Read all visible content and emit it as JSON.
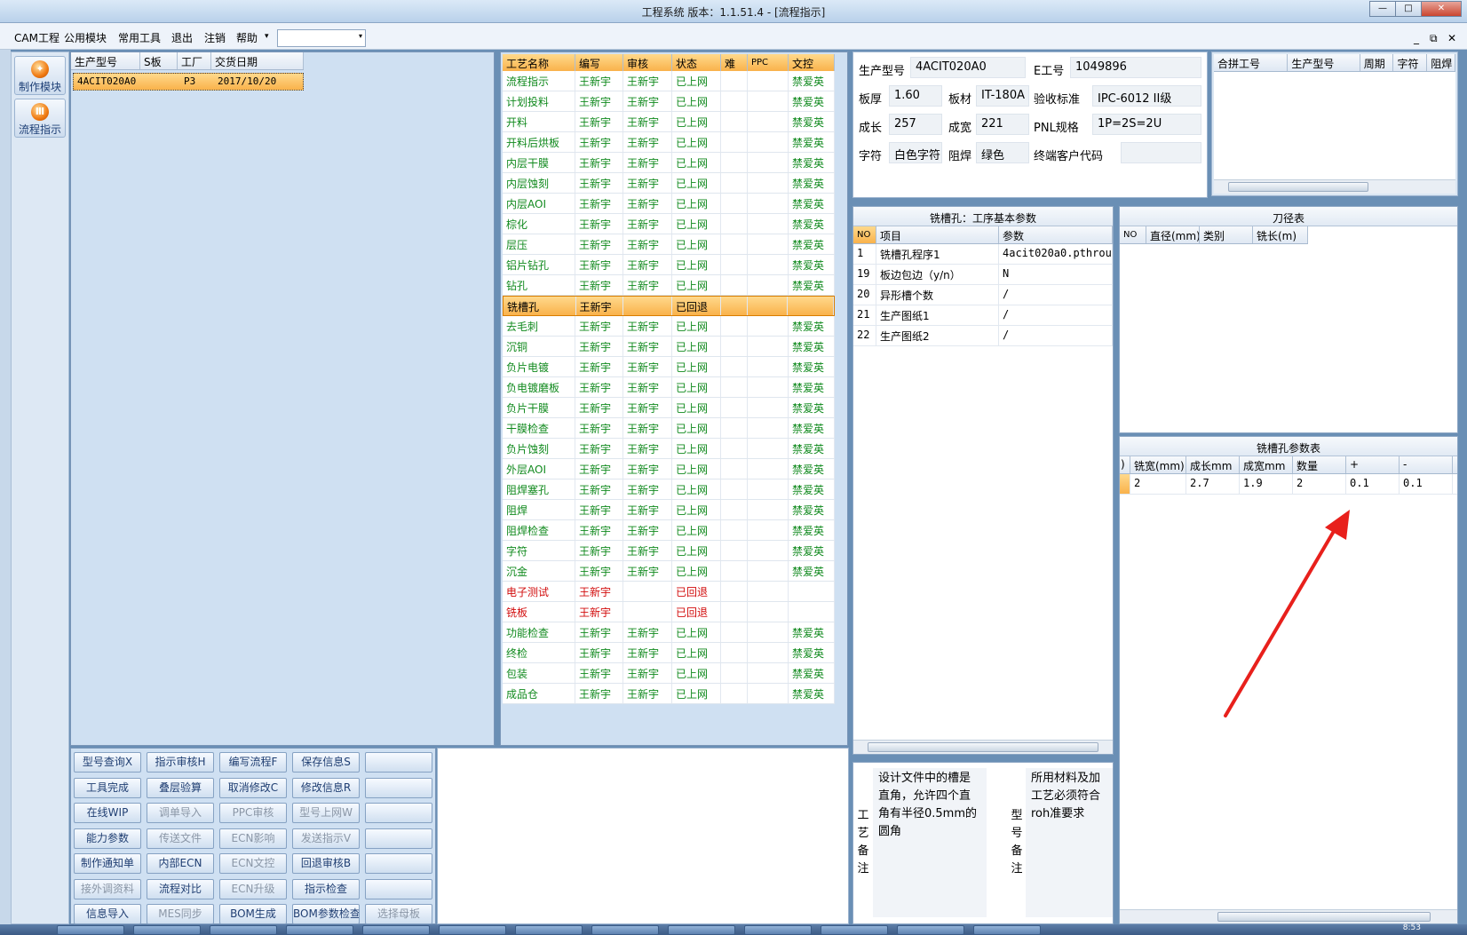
{
  "window": {
    "title": "工程系统   版本：1.1.51.4 - [流程指示]",
    "minimize": "—",
    "maximize": "□",
    "close": "✕"
  },
  "menu": {
    "items": [
      "CAM工程",
      "公用模块",
      "常用工具",
      "退出",
      "注销",
      "帮助"
    ],
    "help_arrow": "▾",
    "combo_value": "",
    "combo_arrow": "▾",
    "mdi_min": "_",
    "mdi_restore": "⧉",
    "mdi_close": "✕"
  },
  "sidebar": {
    "items": [
      {
        "label": "制作模块",
        "icon": "flame-icon",
        "glyph": "✦"
      },
      {
        "label": "流程指示",
        "icon": "flow-icon",
        "glyph": "Ⅲ"
      }
    ]
  },
  "model_list": {
    "headers": [
      "生产型号",
      "S板",
      "工厂",
      "交货日期"
    ],
    "rows": [
      {
        "model": "4ACIT020A0",
        "s": "",
        "factory": "P3",
        "date": "2017/10/20"
      }
    ]
  },
  "process": {
    "headers": [
      "工艺名称",
      "编写",
      "审核",
      "状态",
      "难",
      "PPC",
      "文控"
    ],
    "rows": [
      {
        "name": "流程指示",
        "writer": "王新宇",
        "reviewer": "王新宇",
        "status": "已上网",
        "hard": "",
        "ppc": "",
        "doc": "禁爱英"
      },
      {
        "name": "计划投料",
        "writer": "王新宇",
        "reviewer": "王新宇",
        "status": "已上网",
        "hard": "",
        "ppc": "",
        "doc": "禁爱英"
      },
      {
        "name": "开料",
        "writer": "王新宇",
        "reviewer": "王新宇",
        "status": "已上网",
        "hard": "",
        "ppc": "",
        "doc": "禁爱英"
      },
      {
        "name": "开料后烘板",
        "writer": "王新宇",
        "reviewer": "王新宇",
        "status": "已上网",
        "hard": "",
        "ppc": "",
        "doc": "禁爱英"
      },
      {
        "name": "内层干膜",
        "writer": "王新宇",
        "reviewer": "王新宇",
        "status": "已上网",
        "hard": "",
        "ppc": "",
        "doc": "禁爱英"
      },
      {
        "name": "内层蚀刻",
        "writer": "王新宇",
        "reviewer": "王新宇",
        "status": "已上网",
        "hard": "",
        "ppc": "",
        "doc": "禁爱英"
      },
      {
        "name": "内层AOI",
        "writer": "王新宇",
        "reviewer": "王新宇",
        "status": "已上网",
        "hard": "",
        "ppc": "",
        "doc": "禁爱英"
      },
      {
        "name": "棕化",
        "writer": "王新宇",
        "reviewer": "王新宇",
        "status": "已上网",
        "hard": "",
        "ppc": "",
        "doc": "禁爱英"
      },
      {
        "name": "层压",
        "writer": "王新宇",
        "reviewer": "王新宇",
        "status": "已上网",
        "hard": "",
        "ppc": "",
        "doc": "禁爱英"
      },
      {
        "name": "铝片钻孔",
        "writer": "王新宇",
        "reviewer": "王新宇",
        "status": "已上网",
        "hard": "",
        "ppc": "",
        "doc": "禁爱英"
      },
      {
        "name": "钻孔",
        "writer": "王新宇",
        "reviewer": "王新宇",
        "status": "已上网",
        "hard": "",
        "ppc": "",
        "doc": "禁爱英"
      },
      {
        "name": "铣槽孔",
        "writer": "王新宇",
        "reviewer": "",
        "status": "已回退",
        "hard": "",
        "ppc": "",
        "doc": "",
        "sel": true
      },
      {
        "name": "去毛刺",
        "writer": "王新宇",
        "reviewer": "王新宇",
        "status": "已上网",
        "hard": "",
        "ppc": "",
        "doc": "禁爱英"
      },
      {
        "name": "沉铜",
        "writer": "王新宇",
        "reviewer": "王新宇",
        "status": "已上网",
        "hard": "",
        "ppc": "",
        "doc": "禁爱英"
      },
      {
        "name": "负片电镀",
        "writer": "王新宇",
        "reviewer": "王新宇",
        "status": "已上网",
        "hard": "",
        "ppc": "",
        "doc": "禁爱英"
      },
      {
        "name": "负电镀磨板",
        "writer": "王新宇",
        "reviewer": "王新宇",
        "status": "已上网",
        "hard": "",
        "ppc": "",
        "doc": "禁爱英"
      },
      {
        "name": "负片干膜",
        "writer": "王新宇",
        "reviewer": "王新宇",
        "status": "已上网",
        "hard": "",
        "ppc": "",
        "doc": "禁爱英"
      },
      {
        "name": "干膜检查",
        "writer": "王新宇",
        "reviewer": "王新宇",
        "status": "已上网",
        "hard": "",
        "ppc": "",
        "doc": "禁爱英"
      },
      {
        "name": "负片蚀刻",
        "writer": "王新宇",
        "reviewer": "王新宇",
        "status": "已上网",
        "hard": "",
        "ppc": "",
        "doc": "禁爱英"
      },
      {
        "name": "外层AOI",
        "writer": "王新宇",
        "reviewer": "王新宇",
        "status": "已上网",
        "hard": "",
        "ppc": "",
        "doc": "禁爱英"
      },
      {
        "name": "阻焊塞孔",
        "writer": "王新宇",
        "reviewer": "王新宇",
        "status": "已上网",
        "hard": "",
        "ppc": "",
        "doc": "禁爱英"
      },
      {
        "name": "阻焊",
        "writer": "王新宇",
        "reviewer": "王新宇",
        "status": "已上网",
        "hard": "",
        "ppc": "",
        "doc": "禁爱英"
      },
      {
        "name": "阻焊检查",
        "writer": "王新宇",
        "reviewer": "王新宇",
        "status": "已上网",
        "hard": "",
        "ppc": "",
        "doc": "禁爱英"
      },
      {
        "name": "字符",
        "writer": "王新宇",
        "reviewer": "王新宇",
        "status": "已上网",
        "hard": "",
        "ppc": "",
        "doc": "禁爱英"
      },
      {
        "name": "沉金",
        "writer": "王新宇",
        "reviewer": "王新宇",
        "status": "已上网",
        "hard": "",
        "ppc": "",
        "doc": "禁爱英"
      },
      {
        "name": "电子测试",
        "writer": "王新宇",
        "reviewer": "",
        "status": "已回退",
        "hard": "",
        "ppc": "",
        "doc": "",
        "red": true
      },
      {
        "name": "铣板",
        "writer": "王新宇",
        "reviewer": "",
        "status": "已回退",
        "hard": "",
        "ppc": "",
        "doc": "",
        "red": true
      },
      {
        "name": "功能检查",
        "writer": "王新宇",
        "reviewer": "王新宇",
        "status": "已上网",
        "hard": "",
        "ppc": "",
        "doc": "禁爱英"
      },
      {
        "name": "终检",
        "writer": "王新宇",
        "reviewer": "王新宇",
        "status": "已上网",
        "hard": "",
        "ppc": "",
        "doc": "禁爱英"
      },
      {
        "name": "包装",
        "writer": "王新宇",
        "reviewer": "王新宇",
        "status": "已上网",
        "hard": "",
        "ppc": "",
        "doc": "禁爱英"
      },
      {
        "name": "成品仓",
        "writer": "王新宇",
        "reviewer": "王新宇",
        "status": "已上网",
        "hard": "",
        "ppc": "",
        "doc": "禁爱英"
      }
    ]
  },
  "info": {
    "model_label": "生产型号",
    "model_value": "4ACIT020A0",
    "eno_label": "E工号",
    "eno_value": "1049896",
    "thick_label": "板厚",
    "thick_value": "1.60",
    "material_label": "板材",
    "material_value": "IT-180A",
    "standard_label": "验收标准",
    "standard_value": "IPC-6012 II级",
    "length_label": "成长",
    "length_value": "257",
    "width_label": "成宽",
    "width_value": "221",
    "pnl_label": "PNL规格",
    "pnl_value": "1P=2S=2U",
    "char_label": "字符",
    "char_value": "白色字符",
    "mask_label": "阻焊",
    "mask_value": "绿色",
    "customer_label": "终端客户代码",
    "customer_value": ""
  },
  "combine": {
    "headers": [
      "合拼工号",
      "生产型号",
      "周期",
      "字符",
      "阻焊"
    ]
  },
  "params": {
    "title": "铣槽孔：工序基本参数",
    "headers": [
      "NO",
      "项目",
      "参数"
    ],
    "rows": [
      {
        "no": "1",
        "item": "铣槽孔程序1",
        "value": "4acit020a0.pthrou"
      },
      {
        "no": "19",
        "item": "板边包边（y/n）",
        "value": "N"
      },
      {
        "no": "20",
        "item": "异形槽个数",
        "value": "/"
      },
      {
        "no": "21",
        "item": "生产图纸1",
        "value": "/"
      },
      {
        "no": "22",
        "item": "生产图纸2",
        "value": "/"
      }
    ]
  },
  "tools": {
    "title": "刀径表",
    "headers": [
      "NO",
      "直径(mm)",
      "类别",
      "铣长(m)"
    ]
  },
  "slot_params": {
    "title": "铣槽孔参数表",
    "headers": [
      ")",
      "铣宽(mm)",
      "成长mm",
      "成宽mm",
      "数量",
      "+",
      "-"
    ],
    "rows": [
      {
        "c0": "",
        "width": "2",
        "length": "2.7",
        "w2": "1.9",
        "qty": "2",
        "plus": "0.1",
        "minus": "0.1"
      }
    ]
  },
  "buttons": [
    {
      "label": "型号查询X",
      "enabled": true
    },
    {
      "label": "指示审核H",
      "enabled": true
    },
    {
      "label": "编写流程F",
      "enabled": true
    },
    {
      "label": "保存信息S",
      "enabled": true
    },
    {
      "label": "",
      "enabled": true
    },
    {
      "label": "工具完成",
      "enabled": true
    },
    {
      "label": "叠层验算",
      "enabled": true
    },
    {
      "label": "取消修改C",
      "enabled": true
    },
    {
      "label": "修改信息R",
      "enabled": true
    },
    {
      "label": "",
      "enabled": true
    },
    {
      "label": "在线WIP",
      "enabled": true
    },
    {
      "label": "调单导入",
      "enabled": false
    },
    {
      "label": "PPC审核",
      "enabled": false
    },
    {
      "label": "型号上网W",
      "enabled": false
    },
    {
      "label": "",
      "enabled": true
    },
    {
      "label": "能力参数",
      "enabled": true
    },
    {
      "label": "传送文件",
      "enabled": false
    },
    {
      "label": "ECN影响",
      "enabled": false
    },
    {
      "label": "发送指示V",
      "enabled": false
    },
    {
      "label": "",
      "enabled": true
    },
    {
      "label": "制作通知单",
      "enabled": true
    },
    {
      "label": "内部ECN",
      "enabled": true
    },
    {
      "label": "ECN文控",
      "enabled": false
    },
    {
      "label": "回退审核B",
      "enabled": true
    },
    {
      "label": "",
      "enabled": true
    },
    {
      "label": "接外调资料",
      "enabled": false
    },
    {
      "label": "流程对比",
      "enabled": true
    },
    {
      "label": "ECN升级",
      "enabled": false
    },
    {
      "label": "指示检查",
      "enabled": true
    },
    {
      "label": "",
      "enabled": true
    },
    {
      "label": "信息导入",
      "enabled": true
    },
    {
      "label": "MES同步",
      "enabled": false
    },
    {
      "label": "BOM生成",
      "enabled": true
    },
    {
      "label": "BOM参数检查",
      "enabled": true
    },
    {
      "label": "选择母板",
      "enabled": false
    }
  ],
  "notes": {
    "process_label": [
      "工",
      "艺",
      "备",
      "注"
    ],
    "process_text": "设计文件中的槽是直角，允许四个直角有半径0.5mm的圆角",
    "model_label": [
      "型",
      "号",
      "备",
      "注"
    ],
    "model_text": "所用材料及加工艺必须符合roh准要求"
  },
  "taskbar": {
    "clock": "8:53"
  },
  "colors": {
    "accent_green": "#118a1e",
    "accent_red": "#d20d0d",
    "selection": "#f9b24b",
    "annotation_arrow": "#e8201c"
  }
}
